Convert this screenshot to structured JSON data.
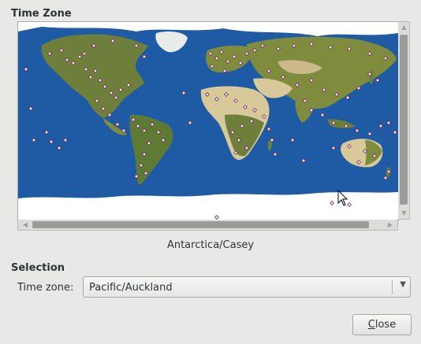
{
  "sections": {
    "time_zone_title": "Time Zone",
    "selection_title": "Selection"
  },
  "map": {
    "hover_label": "Antarctica/Casey",
    "ocean_color": "#1f5aa5",
    "land_color": "#7f8c3e",
    "desert_color": "#d8c99a",
    "ice_color": "#ffffff",
    "marker_color": "#f2f2f2"
  },
  "selection": {
    "label": "Time zone:",
    "value": "Pacific/Auckland"
  },
  "buttons": {
    "close_mnemonic": "C",
    "close_rest": "lose"
  }
}
